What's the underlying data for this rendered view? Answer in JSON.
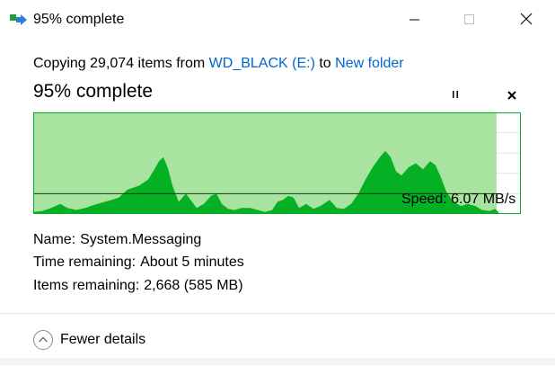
{
  "window": {
    "title": "95% complete"
  },
  "copy": {
    "prefix": "Copying 29,074 items from ",
    "source": "WD_BLACK (E:)",
    "middle": " to ",
    "destination": "New folder"
  },
  "progress": {
    "title": "95% complete",
    "percent": 95,
    "speed": "Speed: 6.07 MB/s"
  },
  "details": {
    "name_label": "Name:",
    "name_value": "System.Messaging",
    "time_label": "Time remaining:",
    "time_value": "About 5 minutes",
    "items_label": "Items remaining:",
    "items_value": "2,668 (585 MB)"
  },
  "footer": {
    "toggle_label": "Fewer details"
  },
  "colors": {
    "graph_fill_light": "#a8e4a0",
    "graph_fill_dark": "#06b025",
    "link": "#0066cc"
  },
  "icons": {
    "app": "copy-files-icon",
    "pause": "pause-icon",
    "cancel": "close-icon",
    "toggle": "chevron-up-circle-icon"
  }
}
